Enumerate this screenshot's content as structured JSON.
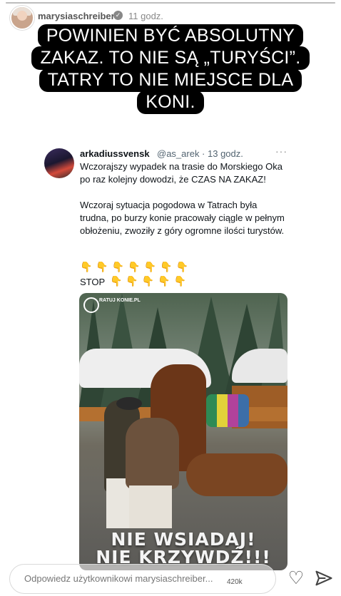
{
  "story": {
    "progress_fraction": 1.0,
    "username": "marysiaschreiber",
    "timestamp": "11 godz.",
    "controls": {
      "pause": "pause-icon",
      "mute": "mute-icon",
      "more": "•••"
    },
    "caption_lines": [
      "POWINIEN BYĆ ABSOLUTNY",
      "ZAKAZ. TO NIE SĄ „TURYŚCI”.",
      "TATRY TO NIE MIEJSCE DLA",
      "KONI."
    ]
  },
  "tweet": {
    "name": "arkadiussvensk",
    "handle": "@as_arek · 13 godz.",
    "more": "···",
    "text": "Wczorajszy wypadek na trasie do Morskiego Oka po raz kolejny dowodzi, że CZAS NA ZAKAZ!\n\nWczoraj sytuacja pogodowa w Tatrach była trudna, po burzy konie pracowały ciągle w pełnym obłożeniu, zwoziły z góry ogromne ilości turystów.",
    "emoji_row_1": "👇👇👇👇👇👇👇",
    "stop_label": "STOP",
    "emoji_row_2": "👇👇👇👇👇"
  },
  "photo": {
    "logo_text": "RATUJ KONIE.PL",
    "slogan_line_1": "NIE WSIADAJ!",
    "slogan_line_2": "NIE KRZYWDŹ!!!"
  },
  "bottom_bar": {
    "reply_placeholder": "Odpowiedz użytkownikowi marysiaschreiber...",
    "views_count": "420k",
    "like_icon": "heart-icon",
    "share_icon": "send-icon"
  }
}
